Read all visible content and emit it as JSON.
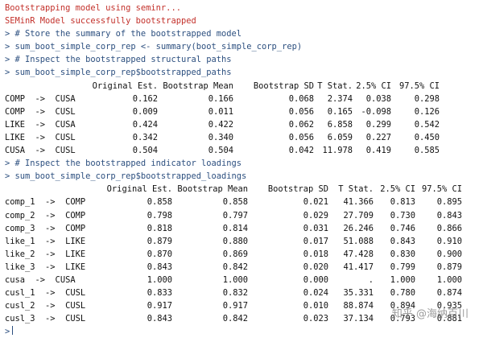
{
  "console": {
    "msg1": "Bootstrapping model using seminr...",
    "msg2": "SEMinR Model successfully bootstrapped",
    "cmd1": "> # Store the summary of the bootstrapped model",
    "cmd2": "> sum_boot_simple_corp_rep <- summary(boot_simple_corp_rep)",
    "cmd3": "> # Inspect the bootstrapped structural paths",
    "cmd4": "> sum_boot_simple_corp_rep$bootstrapped_paths",
    "cmd5": "> # Inspect the bootstrapped indicator loadings",
    "cmd6": "> sum_boot_simple_corp_rep$bootstrapped_loadings",
    "prompt": ">"
  },
  "paths": {
    "headers": [
      "Original Est.",
      "Bootstrap Mean",
      "Bootstrap SD",
      "T Stat.",
      "2.5% CI",
      "97.5% CI"
    ],
    "rows": [
      {
        "label": "COMP  ->  CUSA",
        "v": [
          "0.162",
          "0.166",
          "0.068",
          "2.374",
          "0.038",
          "0.298"
        ]
      },
      {
        "label": "COMP  ->  CUSL",
        "v": [
          "0.009",
          "0.011",
          "0.056",
          "0.165",
          "-0.098",
          "0.126"
        ]
      },
      {
        "label": "LIKE  ->  CUSA",
        "v": [
          "0.424",
          "0.422",
          "0.062",
          "6.858",
          "0.299",
          "0.542"
        ]
      },
      {
        "label": "LIKE  ->  CUSL",
        "v": [
          "0.342",
          "0.340",
          "0.056",
          "6.059",
          "0.227",
          "0.450"
        ]
      },
      {
        "label": "CUSA  ->  CUSL",
        "v": [
          "0.504",
          "0.504",
          "0.042",
          "11.978",
          "0.419",
          "0.585"
        ]
      }
    ]
  },
  "loadings": {
    "headers": [
      "Original Est.",
      "Bootstrap Mean",
      "Bootstrap SD",
      "T Stat.",
      "2.5% CI",
      "97.5% CI"
    ],
    "rows": [
      {
        "label": "comp_1  ->  COMP",
        "v": [
          "0.858",
          "0.858",
          "0.021",
          "41.366",
          "0.813",
          "0.895"
        ]
      },
      {
        "label": "comp_2  ->  COMP",
        "v": [
          "0.798",
          "0.797",
          "0.029",
          "27.709",
          "0.730",
          "0.843"
        ]
      },
      {
        "label": "comp_3  ->  COMP",
        "v": [
          "0.818",
          "0.814",
          "0.031",
          "26.246",
          "0.746",
          "0.866"
        ]
      },
      {
        "label": "like_1  ->  LIKE",
        "v": [
          "0.879",
          "0.880",
          "0.017",
          "51.088",
          "0.843",
          "0.910"
        ]
      },
      {
        "label": "like_2  ->  LIKE",
        "v": [
          "0.870",
          "0.869",
          "0.018",
          "47.428",
          "0.830",
          "0.900"
        ]
      },
      {
        "label": "like_3  ->  LIKE",
        "v": [
          "0.843",
          "0.842",
          "0.020",
          "41.417",
          "0.799",
          "0.879"
        ]
      },
      {
        "label": "cusa  ->  CUSA",
        "v": [
          "1.000",
          "1.000",
          "0.000",
          ".",
          "1.000",
          "1.000"
        ]
      },
      {
        "label": "cusl_1  ->  CUSL",
        "v": [
          "0.833",
          "0.832",
          "0.024",
          "35.331",
          "0.780",
          "0.874"
        ]
      },
      {
        "label": "cusl_2  ->  CUSL",
        "v": [
          "0.917",
          "0.917",
          "0.010",
          "88.874",
          "0.894",
          "0.935"
        ]
      },
      {
        "label": "cusl_3  ->  CUSL",
        "v": [
          "0.843",
          "0.842",
          "0.023",
          "37.134",
          "0.793",
          "0.881"
        ]
      }
    ]
  },
  "watermark": "知乎 @海纳百川"
}
